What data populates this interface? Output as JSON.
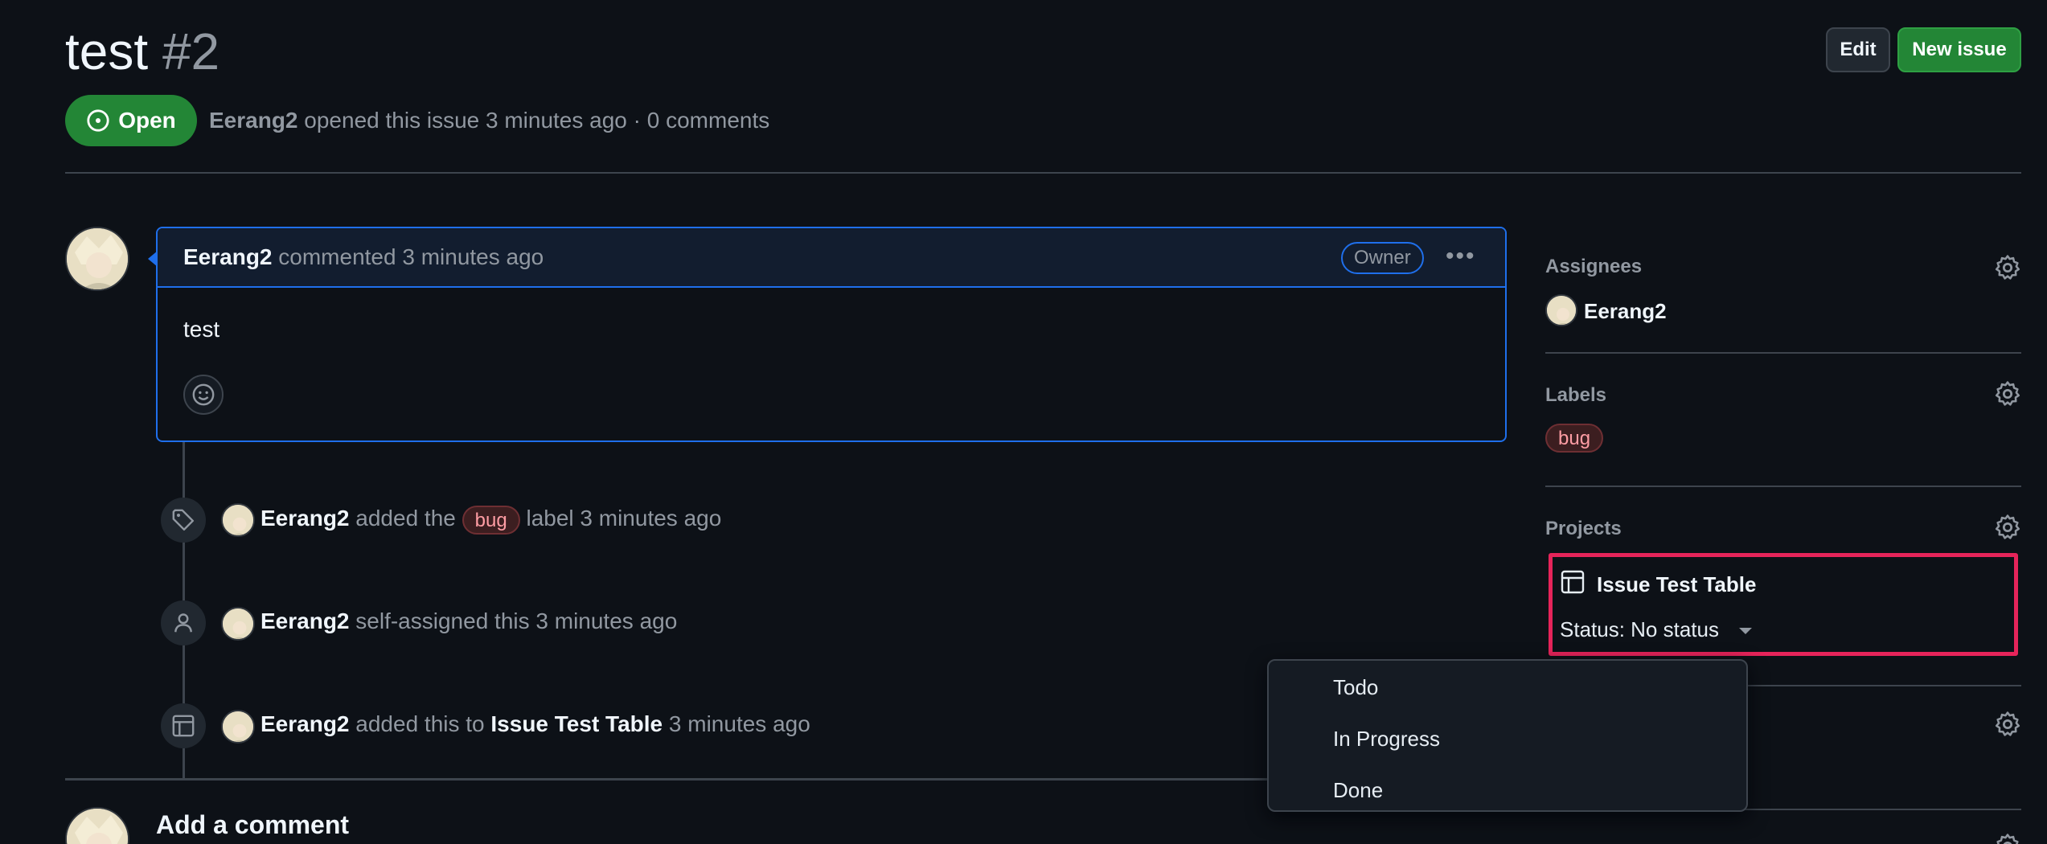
{
  "issue": {
    "title": "test",
    "number": "#2",
    "state_label": "Open",
    "author": "Eerang2",
    "opened_text": "opened this issue 3 minutes ago · 0 comments"
  },
  "header_actions": {
    "edit_label": "Edit",
    "new_issue_label": "New issue"
  },
  "comment": {
    "author": "Eerang2",
    "meta": "commented 3 minutes ago",
    "role_badge": "Owner",
    "body": "test"
  },
  "timeline": [
    {
      "actor": "Eerang2",
      "pre": "added the",
      "label": "bug",
      "post": "label 3 minutes ago",
      "icon": "tag-icon"
    },
    {
      "actor": "Eerang2",
      "text": "self-assigned this 3 minutes ago",
      "icon": "person-icon"
    },
    {
      "actor": "Eerang2",
      "pre": "added this to",
      "project": "Issue Test Table",
      "post": "3 minutes ago",
      "icon": "table-icon"
    }
  ],
  "sidebar": {
    "assignees_heading": "Assignees",
    "assignee": "Eerang2",
    "labels_heading": "Labels",
    "label": "bug",
    "projects_heading": "Projects",
    "project_name": "Issue Test Table",
    "project_status": "Status: No status"
  },
  "status_options": [
    "Todo",
    "In Progress",
    "Done"
  ],
  "add_comment_heading": "Add a comment",
  "colors": {
    "accent_green": "#238636",
    "highlight_pink": "#e6245a",
    "link_blue": "#1f6feb",
    "bg": "#0d1117"
  }
}
